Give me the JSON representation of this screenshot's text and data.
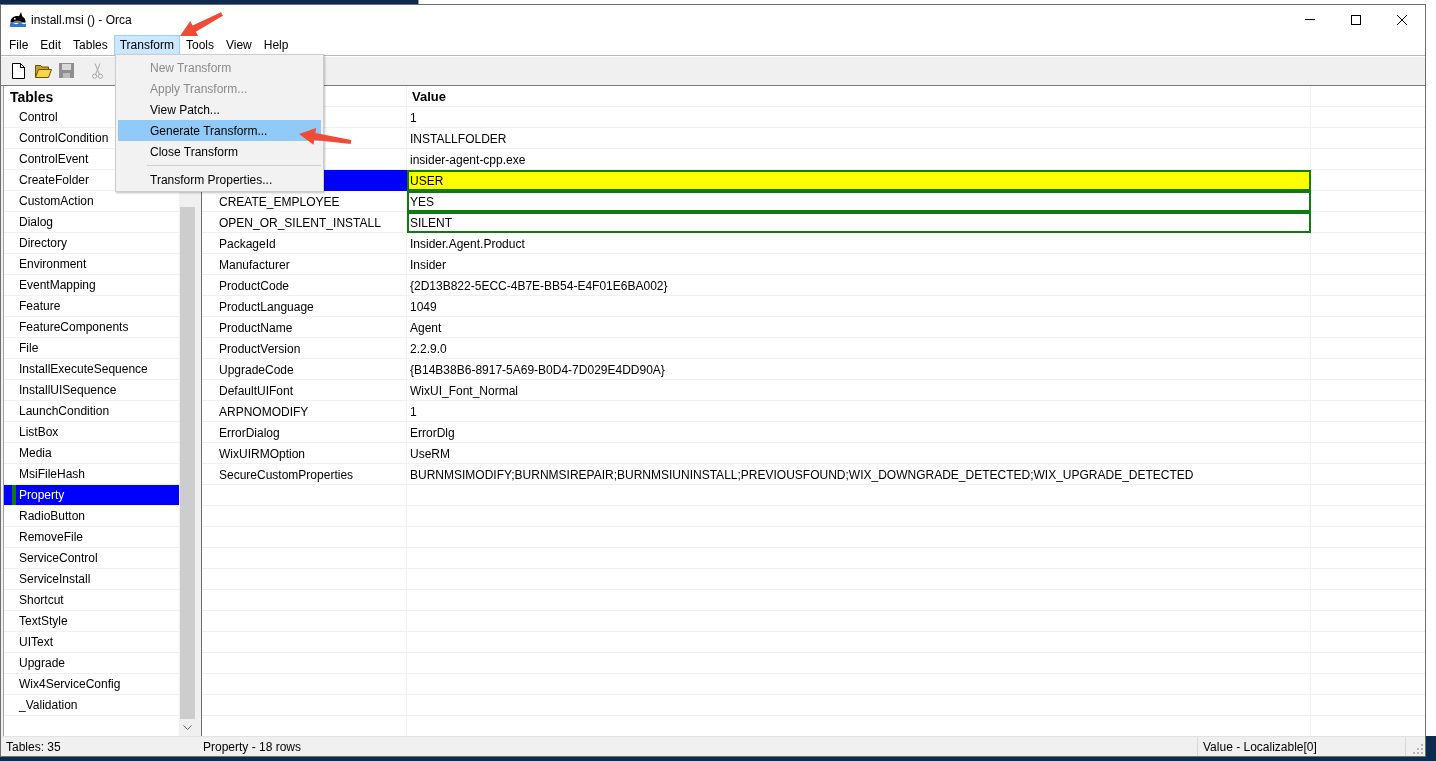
{
  "window": {
    "title": "install.msi () - Orca"
  },
  "menu_bar": [
    {
      "label": "File",
      "selected": false
    },
    {
      "label": "Edit",
      "selected": false
    },
    {
      "label": "Tables",
      "selected": false
    },
    {
      "label": "Transform",
      "selected": true
    },
    {
      "label": "Tools",
      "selected": false
    },
    {
      "label": "View",
      "selected": false
    },
    {
      "label": "Help",
      "selected": false
    }
  ],
  "toolbar": [
    {
      "kind": "new",
      "disabled": false
    },
    {
      "kind": "open",
      "disabled": false
    },
    {
      "kind": "save",
      "disabled": true
    },
    {
      "kind": "cut",
      "disabled": true
    }
  ],
  "transform_menu": [
    {
      "items": [
        {
          "label": "New Transform",
          "disabled": true,
          "selected": false
        },
        {
          "label": "Apply Transform...",
          "disabled": true,
          "selected": false
        },
        {
          "label": "View Patch...",
          "disabled": false,
          "selected": false
        },
        {
          "label": "Generate Transform...",
          "disabled": false,
          "selected": true
        },
        {
          "label": "Close Transform",
          "disabled": false,
          "selected": false
        }
      ]
    },
    {
      "items": [
        {
          "label": "Transform Properties...",
          "disabled": false,
          "selected": false
        }
      ]
    }
  ],
  "tables": {
    "title": "Tables",
    "items": [
      {
        "name": "Control",
        "selected": false,
        "changed": false
      },
      {
        "name": "ControlCondition",
        "selected": false,
        "changed": false
      },
      {
        "name": "ControlEvent",
        "selected": false,
        "changed": false
      },
      {
        "name": "CreateFolder",
        "selected": false,
        "changed": false
      },
      {
        "name": "CustomAction",
        "selected": false,
        "changed": false
      },
      {
        "name": "Dialog",
        "selected": false,
        "changed": false
      },
      {
        "name": "Directory",
        "selected": false,
        "changed": false
      },
      {
        "name": "Environment",
        "selected": false,
        "changed": false
      },
      {
        "name": "EventMapping",
        "selected": false,
        "changed": false
      },
      {
        "name": "Feature",
        "selected": false,
        "changed": false
      },
      {
        "name": "FeatureComponents",
        "selected": false,
        "changed": false
      },
      {
        "name": "File",
        "selected": false,
        "changed": false
      },
      {
        "name": "InstallExecuteSequence",
        "selected": false,
        "changed": false
      },
      {
        "name": "InstallUISequence",
        "selected": false,
        "changed": false
      },
      {
        "name": "LaunchCondition",
        "selected": false,
        "changed": false
      },
      {
        "name": "ListBox",
        "selected": false,
        "changed": false
      },
      {
        "name": "Media",
        "selected": false,
        "changed": false
      },
      {
        "name": "MsiFileHash",
        "selected": false,
        "changed": false
      },
      {
        "name": "Property",
        "selected": true,
        "changed": true
      },
      {
        "name": "RadioButton",
        "selected": false,
        "changed": false
      },
      {
        "name": "RemoveFile",
        "selected": false,
        "changed": false
      },
      {
        "name": "ServiceControl",
        "selected": false,
        "changed": false
      },
      {
        "name": "ServiceInstall",
        "selected": false,
        "changed": false
      },
      {
        "name": "Shortcut",
        "selected": false,
        "changed": false
      },
      {
        "name": "TextStyle",
        "selected": false,
        "changed": false
      },
      {
        "name": "UIText",
        "selected": false,
        "changed": false
      },
      {
        "name": "Upgrade",
        "selected": false,
        "changed": false
      },
      {
        "name": "Wix4ServiceConfig",
        "selected": false,
        "changed": false
      },
      {
        "name": "_Validation",
        "selected": false,
        "changed": false
      }
    ]
  },
  "grid": {
    "columns": {
      "value": "Value"
    },
    "rows": [
      {
        "value": "1",
        "selected": false,
        "changed": false
      },
      {
        "value": "INSTALLFOLDER",
        "selected": false,
        "changed": false
      },
      {
        "value": "insider-agent-cpp.exe",
        "selected": false,
        "changed": false
      },
      {
        "value": "USER",
        "selected": true,
        "changed": true
      },
      {
        "property": "CREATE_EMPLOYEE",
        "value": "YES",
        "selected": false,
        "changed": true
      },
      {
        "property": "OPEN_OR_SILENT_INSTALL",
        "value": "SILENT",
        "selected": false,
        "changed": true
      },
      {
        "property": "PackageId",
        "value": "Insider.Agent.Product",
        "selected": false,
        "changed": false
      },
      {
        "property": "Manufacturer",
        "value": "Insider",
        "selected": false,
        "changed": false
      },
      {
        "property": "ProductCode",
        "value": "{2D13B822-5ECC-4B7E-BB54-E4F01E6BA002}",
        "selected": false,
        "changed": false
      },
      {
        "property": "ProductLanguage",
        "value": "1049",
        "selected": false,
        "changed": false
      },
      {
        "property": "ProductName",
        "value": "Agent",
        "selected": false,
        "changed": false
      },
      {
        "property": "ProductVersion",
        "value": "2.2.9.0",
        "selected": false,
        "changed": false
      },
      {
        "property": "UpgradeCode",
        "value": "{B14B38B6-8917-5A69-B0D4-7D029E4DD90A}",
        "selected": false,
        "changed": false
      },
      {
        "property": "DefaultUIFont",
        "value": "WixUI_Font_Normal",
        "selected": false,
        "changed": false
      },
      {
        "property": "ARPNOMODIFY",
        "value": "1",
        "selected": false,
        "changed": false
      },
      {
        "property": "ErrorDialog",
        "value": "ErrorDlg",
        "selected": false,
        "changed": false
      },
      {
        "property": "WixUIRMOption",
        "value": "UseRM",
        "selected": false,
        "changed": false
      },
      {
        "property": "SecureCustomProperties",
        "value": "BURNMSIMODIFY;BURNMSIREPAIR;BURNMSIUNINSTALL;PREVIOUSFOUND;WIX_DOWNGRADE_DETECTED;WIX_UPGRADE_DETECTED",
        "selected": false,
        "changed": false
      }
    ]
  },
  "status_bar": [
    "Tables: 35",
    "Property - 18 rows",
    "Value - Localizable[0]"
  ]
}
